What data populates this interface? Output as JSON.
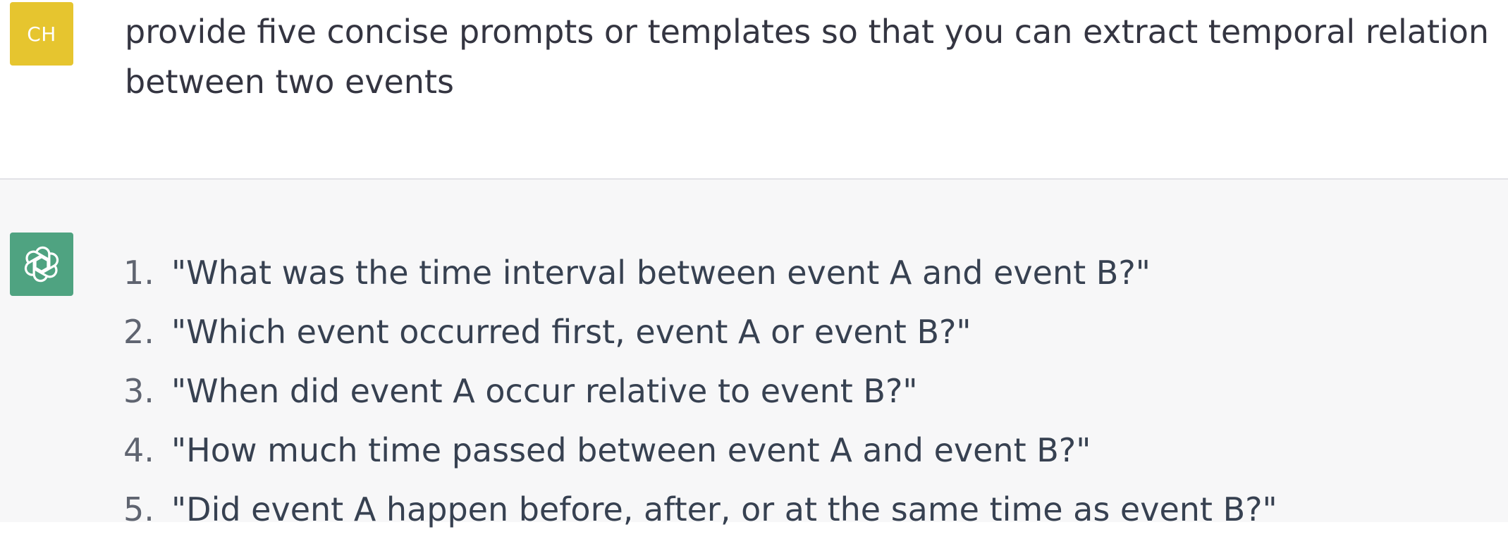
{
  "user_message": {
    "avatar_initials": "CH",
    "avatar_color": "#e6c52f",
    "text": "provide five concise prompts or templates so that you can extract temporal relation between two events"
  },
  "assistant_message": {
    "avatar_icon": "openai-logo-icon",
    "avatar_color": "#4fa381",
    "items": [
      {
        "num": "1.",
        "text": "\"What was the time interval between event A and event B?\""
      },
      {
        "num": "2.",
        "text": "\"Which event occurred first, event A or event B?\""
      },
      {
        "num": "3.",
        "text": "\"When did event A occur relative to event B?\""
      },
      {
        "num": "4.",
        "text": "\"How much time passed between event A and event B?\""
      },
      {
        "num": "5.",
        "text": "\"Did event A happen before, after, or at the same time as event B?\""
      }
    ]
  }
}
